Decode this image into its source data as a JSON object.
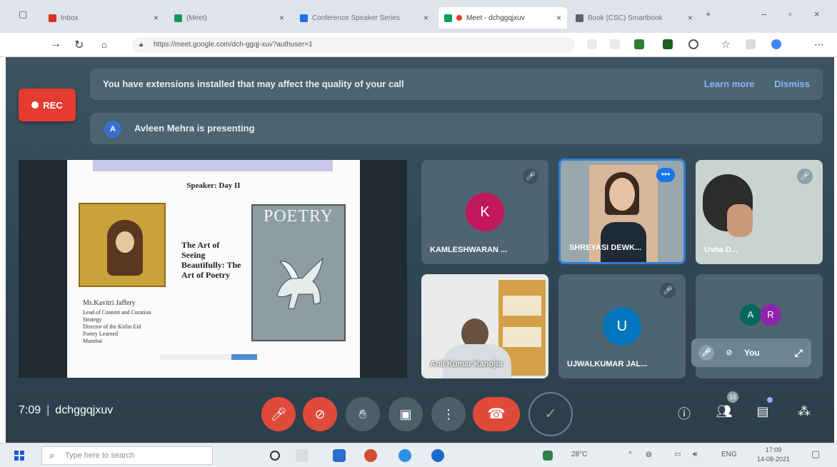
{
  "browser": {
    "tabs": [
      {
        "label": "Inbox",
        "active": false
      },
      {
        "label": "(Meet)",
        "active": false
      },
      {
        "label": "Conference Speaker Series",
        "active": false
      },
      {
        "label": "Meet - dchggqjxuv",
        "active": true
      },
      {
        "label": "Book (CSC) Smartbook",
        "active": false
      }
    ],
    "url": "https://meet.google.com/dch-ggqj-xuv?authuser=1"
  },
  "meet": {
    "rec_label": "REC",
    "extension_warning": "You have extensions installed that may affect the quality of your call",
    "learn_more": "Learn more",
    "dismiss": "Dismiss",
    "presenter_initial": "A",
    "presenting_text": "Avleen Mehra is presenting",
    "meeting_time": "7:09",
    "meeting_code": "dchggqjxuv",
    "self_label": "You",
    "people_count": "15"
  },
  "slide": {
    "speaker_heading": "Speaker: Day II",
    "title": "The Art of Seeing Beautifully: The Art of Poetry",
    "cover_title": "POETRY",
    "caption_name": "Ms.Kavitri Jaffery",
    "caption_lines": [
      "Lead of Content and Curation",
      "Strategy",
      "Director of the Kirlin Eid",
      "Poetry Learned",
      "Mumbai"
    ]
  },
  "participants": [
    {
      "name": "KAMLESHWARAN ...",
      "initial": "K",
      "avatar_color": "#c2185b",
      "muted": true,
      "video": false
    },
    {
      "name": "SHREYASI DEWK...",
      "initial": "",
      "muted": false,
      "video": true,
      "highlight": true
    },
    {
      "name": "Usha D...",
      "initial": "",
      "muted": false,
      "video": true
    },
    {
      "name": "Anil Kumar Kanojia",
      "initial": "",
      "muted": false,
      "video": true
    },
    {
      "name": "UJWALKUMAR JAL...",
      "initial": "U",
      "avatar_color": "#0277bd",
      "muted": true,
      "video": false
    },
    {
      "name": "",
      "initials": [
        "A",
        "R"
      ],
      "avatar_colors": [
        "#00695c",
        "#8e24aa"
      ],
      "muted": false,
      "video": false
    }
  ],
  "taskbar": {
    "search_placeholder": "Type here to search",
    "weather": "28°C",
    "lang": "ENG",
    "time": "17:09",
    "date": "14-08-2021"
  },
  "colors": {
    "meet_bg": "#304552",
    "red": "#e04a3b",
    "blue": "#1a73e8"
  }
}
